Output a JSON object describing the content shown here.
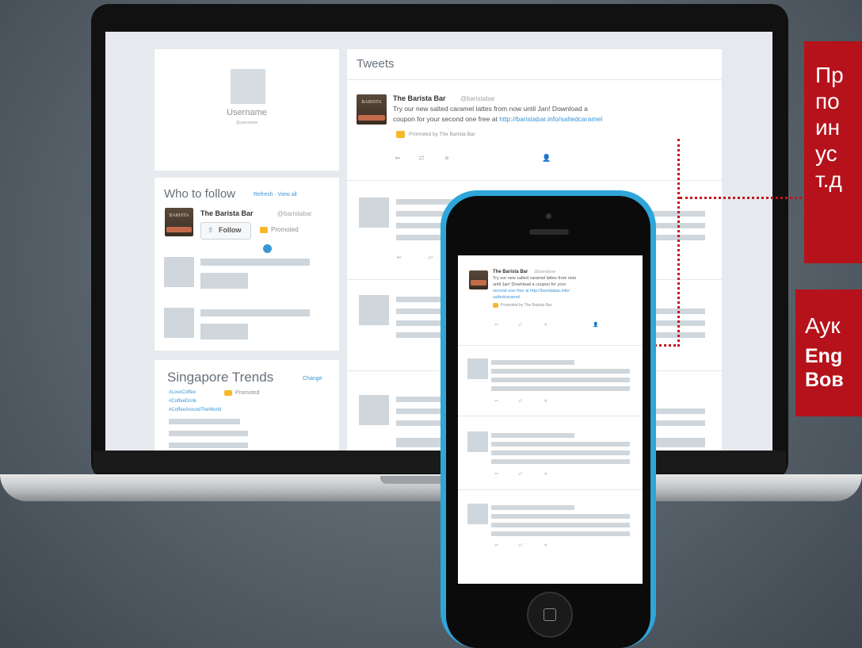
{
  "profile": {
    "name": "Username",
    "handle": "@username"
  },
  "tweets": {
    "header": "Tweets",
    "promoted_tweet": {
      "author": "The Barista Bar",
      "handle": "@baristabar",
      "text_line1": "Try our new salted caramel lattes from now until Jan! Download a",
      "text_line2": "coupon for your second one free at ",
      "link": "http://baristabar.info/saltedcaramel",
      "promoted_by": "Promoted by The Barista Bar"
    }
  },
  "who_to_follow": {
    "title": "Who to follow",
    "actions": "Refresh · View all",
    "account": {
      "name": "The Barista Bar",
      "handle": "@baristabar",
      "follow_label": "Follow",
      "promoted_label": "Promoted"
    }
  },
  "trends": {
    "title": "Singapore Trends",
    "change_label": "Change",
    "items": [
      "#LoveCoffee",
      "#CoffeeDrink",
      "#CoffeeAroundTheWorld"
    ],
    "promoted_label": "Promoted"
  },
  "phone_tweet": {
    "author": "The Barista Bar",
    "handle": "@baristabar",
    "text_line1": "Try our new salted caramel lattes from now",
    "text_line2": "until Jan! Download a coupon for your",
    "text_line3": "second one free at http://baristabar.info/",
    "text_line4": "saltedcaramel",
    "promoted_by": "Promoted by The Barista Bar"
  },
  "avatar_label": "BARISTA",
  "callouts": {
    "box1_lines": [
      "Пр",
      "по",
      "ин",
      "ус",
      "т.д"
    ],
    "box2_line1": "Аук",
    "box2_line2": "Eng",
    "box2_line3": "Вов"
  },
  "colors": {
    "accent_red": "#b5121b",
    "twitter_blue": "#3a95d6",
    "phone_blue": "#2ea6da",
    "promoted_orange": "#f6b72a"
  }
}
